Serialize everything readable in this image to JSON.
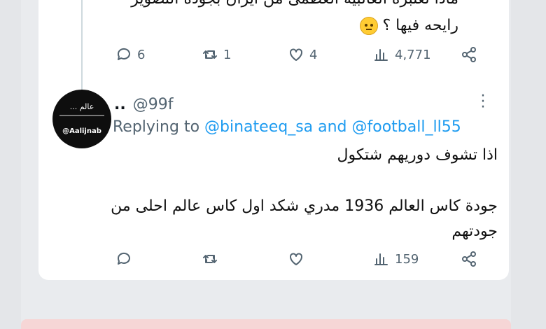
{
  "first_tweet": {
    "partial_line": "ماذا تعتبره الغالبية العظمى من ايران بجودة التصوير",
    "last_line": "رايحه فيها ؟",
    "reaction_emoji": "face-with-rolling-eyes-icon",
    "stats": {
      "replies": "6",
      "retweets": "1",
      "likes": "4",
      "views": "4,771"
    }
  },
  "reply_tweet": {
    "avatar": {
      "line1": "عالم ...",
      "line2": "@Aalijnab"
    },
    "username": "..",
    "handle": "@99f",
    "replying_prefix": "Replying to",
    "replying_to": "@binateeq_sa and @football_ll55",
    "body_line1": "اذا تشوف دوريهم شتكول",
    "body_paragraph": "جودة كاس العالم 1936 مدري شكد اول كاس عالم احلى من جودتهم",
    "stats": {
      "replies": "",
      "retweets": "",
      "likes": "",
      "views": "159"
    }
  },
  "colors": {
    "accent": "#1d9bf0",
    "muted": "#536471",
    "card": "#ffffff",
    "background": "#e9ebee"
  }
}
